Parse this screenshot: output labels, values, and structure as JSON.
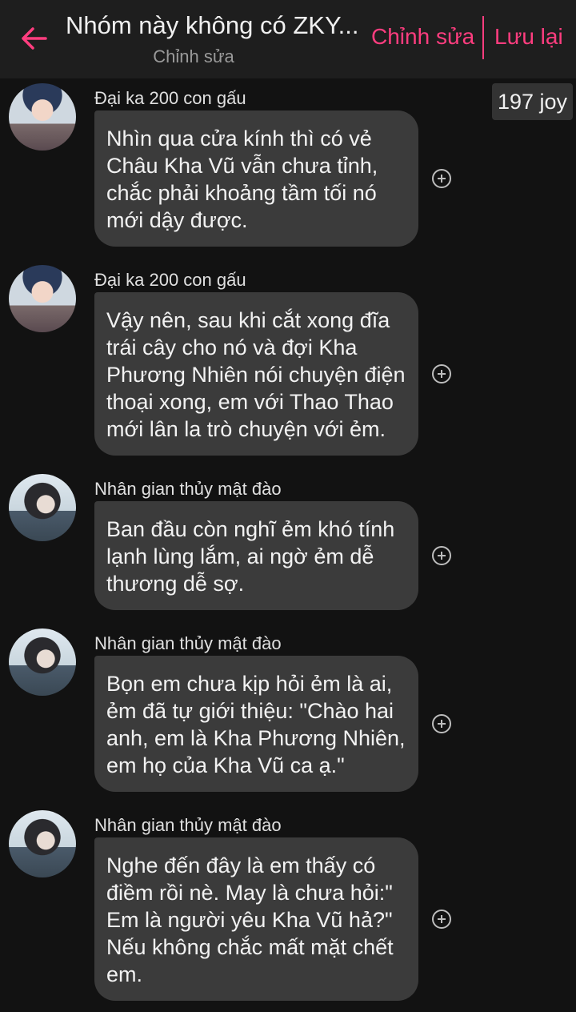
{
  "header": {
    "title": "Nhóm này không có ZKY...",
    "subtitle": "Chỉnh sửa",
    "edit_label": "Chỉnh sửa",
    "save_label": "Lưu lại",
    "accent_color": "#ff3d7f"
  },
  "joy_badge": "197 joy",
  "messages": [
    {
      "sender": "Đại ka 200 con gấu",
      "text": "Nhìn qua cửa kính thì có vẻ Châu Kha Vũ vẫn chưa tỉnh, chắc phải khoảng tầm tối nó mới dậy được."
    },
    {
      "sender": "Đại ka 200 con gấu",
      "text": "Vậy nên, sau khi cắt xong đĩa trái cây cho nó và đợi Kha Phương Nhiên nói chuyện điện thoại xong, em với Thao Thao mới lân la trò chuyện với ẻm."
    },
    {
      "sender": "Nhân gian thủy mật đào",
      "text": "Ban đầu còn nghĩ ẻm khó tính lạnh lùng lắm, ai ngờ ẻm dễ thương dễ sợ."
    },
    {
      "sender": "Nhân gian thủy mật đào",
      "text": "Bọn em chưa kịp hỏi ẻm là ai, ẻm đã tự giới thiệu: \"Chào hai anh, em là Kha Phương Nhiên, em họ của Kha Vũ ca ạ.\""
    },
    {
      "sender": "Nhân gian thủy mật đào",
      "text": "Nghe đến đây là em thấy có điềm rồi nè. May là chưa hỏi:\" Em là người yêu Kha Vũ hả?\" Nếu không chắc mất mặt chết em."
    }
  ]
}
